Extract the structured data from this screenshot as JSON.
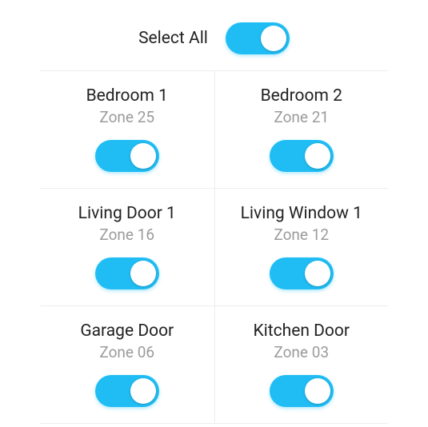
{
  "selectAll": {
    "label": "Select All",
    "on": true
  },
  "zones": [
    {
      "name": "Bedroom 1",
      "sub": "Zone 25",
      "on": true
    },
    {
      "name": "Bedroom 2",
      "sub": "Zone 21",
      "on": true
    },
    {
      "name": "Living Door 1",
      "sub": "Zone 16",
      "on": true
    },
    {
      "name": "Living Window 1",
      "sub": "Zone 12",
      "on": true
    },
    {
      "name": "Garage Door",
      "sub": "Zone 06",
      "on": true
    },
    {
      "name": "Kitchen Door",
      "sub": "Zone 03",
      "on": true
    }
  ],
  "colors": {
    "accent": "#20bdf4",
    "border": "#ededed",
    "text": "#222222",
    "subtext": "#9b9b9b"
  }
}
